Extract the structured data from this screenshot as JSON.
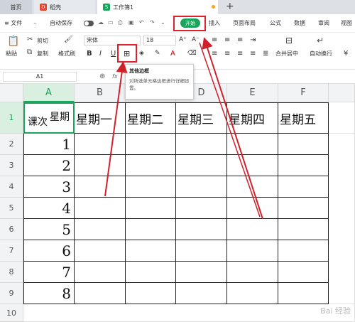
{
  "tabs": {
    "home": "首页",
    "daoke": "稻壳",
    "workbook": "工作簿1",
    "new_tab": "+"
  },
  "menu": {
    "file": "≡ 文件",
    "autosave": "自动保存",
    "start": "开始",
    "insert": "插入",
    "page_layout": "页面布局",
    "formula": "公式",
    "data": "数据",
    "review": "审阅",
    "view": "视图"
  },
  "ribbon": {
    "paste": "粘贴",
    "cut": "剪切",
    "copy": "复制",
    "format_painter": "格式刷",
    "font_name": "宋体",
    "font_size": "18",
    "merge_center": "合并居中",
    "wrap_text": "自动换行",
    "currency": "¥"
  },
  "tooltip": {
    "title": "其他边框",
    "body": "对所选单元格边框进行详细设置。"
  },
  "formula_bar": {
    "name_box": "A1",
    "zoom_icon": "zoom-icon",
    "fx": "fx"
  },
  "grid": {
    "columns": [
      "A",
      "B",
      "C",
      "D",
      "E",
      "F"
    ],
    "rows": [
      "1",
      "2",
      "3",
      "4",
      "5",
      "6",
      "7",
      "8",
      "9",
      "10"
    ],
    "header_cell_top": "星期",
    "header_cell_bottom": "课次",
    "weekdays": [
      "星期一",
      "星期二",
      "星期三",
      "星期四",
      "星期五"
    ],
    "lesson_numbers": [
      "1",
      "2",
      "3",
      "4",
      "5",
      "6",
      "7",
      "8"
    ]
  },
  "watermark": "Bai 经验",
  "colors": {
    "accent": "#1aa35b",
    "highlight_box": "#e0202a"
  }
}
